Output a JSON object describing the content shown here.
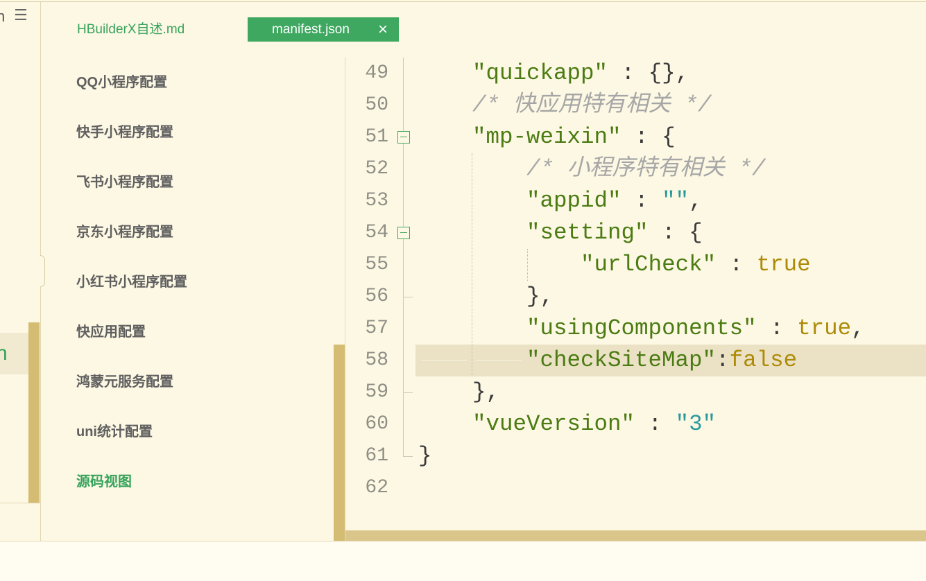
{
  "theme": {
    "background": "#fdf8e4",
    "accent": "#3ea760",
    "accent_text": "#37a35c",
    "scrollbar": "#d4bc72",
    "current_line": "#ebe2c6"
  },
  "left_strip": {
    "top_glyph": "n",
    "menu_icon": "☰",
    "active_item_glyph": "n"
  },
  "tabs": [
    {
      "label": "HBuilderX自述.md",
      "active": false
    },
    {
      "label": "manifest.json",
      "active": true,
      "close_icon": "×"
    }
  ],
  "nav": {
    "items": [
      {
        "label": "QQ小程序配置",
        "active": false
      },
      {
        "label": "快手小程序配置",
        "active": false
      },
      {
        "label": "飞书小程序配置",
        "active": false
      },
      {
        "label": "京东小程序配置",
        "active": false
      },
      {
        "label": "小红书小程序配置",
        "active": false
      },
      {
        "label": "快应用配置",
        "active": false
      },
      {
        "label": "鸿蒙元服务配置",
        "active": false
      },
      {
        "label": "uni统计配置",
        "active": false
      },
      {
        "label": "源码视图",
        "active": true
      }
    ]
  },
  "editor": {
    "lines": [
      {
        "num": "49",
        "tokens": [
          {
            "t": "    "
          },
          {
            "t": "\"quickapp\"",
            "color": "#4b7b12"
          },
          {
            "t": " : {},",
            "color": "#3a3a3a"
          }
        ]
      },
      {
        "num": "50",
        "tokens": [
          {
            "t": "    "
          },
          {
            "t": "/* 快应用特有相关 */",
            "color": "#a6a6a6",
            "italic": true
          }
        ]
      },
      {
        "num": "51",
        "foldable": true,
        "tokens": [
          {
            "t": "    "
          },
          {
            "t": "\"mp-weixin\"",
            "color": "#4b7b12"
          },
          {
            "t": " : {",
            "color": "#3a3a3a"
          }
        ]
      },
      {
        "num": "52",
        "tokens": [
          {
            "t": "        "
          },
          {
            "t": "/* 小程序特有相关 */",
            "color": "#a6a6a6",
            "italic": true
          }
        ]
      },
      {
        "num": "53",
        "tokens": [
          {
            "t": "        "
          },
          {
            "t": "\"appid\"",
            "color": "#4b7b12"
          },
          {
            "t": " : ",
            "color": "#3a3a3a"
          },
          {
            "t": "\"\"",
            "color": "#2a999b"
          },
          {
            "t": ",",
            "color": "#3a3a3a"
          }
        ]
      },
      {
        "num": "54",
        "foldable": true,
        "tokens": [
          {
            "t": "        "
          },
          {
            "t": "\"setting\"",
            "color": "#4b7b12"
          },
          {
            "t": " : {",
            "color": "#3a3a3a"
          }
        ]
      },
      {
        "num": "55",
        "tokens": [
          {
            "t": "            "
          },
          {
            "t": "\"urlCheck\"",
            "color": "#4b7b12"
          },
          {
            "t": " : ",
            "color": "#3a3a3a"
          },
          {
            "t": "true",
            "color": "#ad8a08"
          }
        ]
      },
      {
        "num": "56",
        "tokens": [
          {
            "t": "        "
          },
          {
            "t": "},",
            "color": "#3a3a3a"
          }
        ]
      },
      {
        "num": "57",
        "tokens": [
          {
            "t": "        "
          },
          {
            "t": "\"usingComponents\"",
            "color": "#4b7b12"
          },
          {
            "t": " : ",
            "color": "#3a3a3a"
          },
          {
            "t": "true",
            "color": "#ad8a08"
          },
          {
            "t": ",",
            "color": "#3a3a3a"
          }
        ]
      },
      {
        "num": "58",
        "highlighted": true,
        "tokens": [
          {
            "t": "\t",
            "tab": true
          },
          {
            "t": "\t",
            "tab": true
          },
          {
            "t": "\"checkSiteMap\"",
            "color": "#4b7b12"
          },
          {
            "t": ":",
            "color": "#3a3a3a"
          },
          {
            "t": "false",
            "color": "#ad8a08"
          }
        ]
      },
      {
        "num": "59",
        "tokens": [
          {
            "t": "    "
          },
          {
            "t": "},",
            "color": "#3a3a3a"
          }
        ]
      },
      {
        "num": "60",
        "tokens": [
          {
            "t": "    "
          },
          {
            "t": "\"vueVersion\"",
            "color": "#4b7b12"
          },
          {
            "t": " : ",
            "color": "#3a3a3a"
          },
          {
            "t": "\"3\"",
            "color": "#2a999b"
          }
        ]
      },
      {
        "num": "61",
        "tokens": [
          {
            "t": "}",
            "color": "#3a3a3a"
          }
        ]
      },
      {
        "num": "62",
        "tokens": []
      }
    ]
  }
}
